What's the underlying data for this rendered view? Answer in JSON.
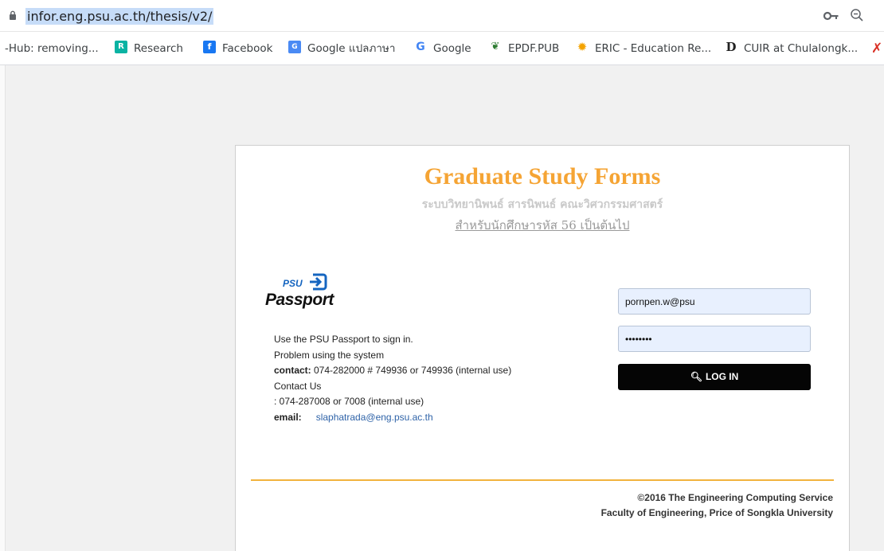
{
  "browser": {
    "url": "infor.eng.psu.ac.th/thesis/v2/",
    "bookmarks": [
      {
        "label": "-Hub: removing..."
      },
      {
        "label": "Research",
        "icon": "researchgate-icon"
      },
      {
        "label": "Facebook",
        "icon": "facebook-icon"
      },
      {
        "label": "Google แปลภาษา",
        "icon": "google-translate-icon"
      },
      {
        "label": "Google",
        "icon": "google-icon"
      },
      {
        "label": "EPDF.PUB",
        "icon": "epdf-icon"
      },
      {
        "label": "ERIC - Education Re...",
        "icon": "eric-icon"
      },
      {
        "label": "CUIR at Chulalongk...",
        "icon": "cuir-icon"
      }
    ]
  },
  "page": {
    "title": "Graduate Study Forms",
    "subtitle": "ระบบวิทยานิพนธ์ สารนิพนธ์ คณะวิศวกรรมศาสตร์",
    "sublink": "สำหรับนักศึกษารหัส 56 เป็นต้นไป",
    "logo": {
      "top": "PSU",
      "bottom": "Passport"
    },
    "info": {
      "line1": "Use the PSU Passport to sign in.",
      "line2": "Problem using the system",
      "contact_label": "contact:",
      "contact_value": " 074-282000 # 749936 or 749936 (internal use)",
      "line4": "Contact Us",
      "line5": ": 074-287008 or 7008 (internal use)",
      "email_label": "email:",
      "email_value": "slaphatrada@eng.psu.ac.th"
    },
    "form": {
      "username": "pornpen.w@psu",
      "password": "••••••••",
      "login_label": "LOG IN"
    },
    "footer": {
      "line1": "©2016 The Engineering Computing Service",
      "line2": "Faculty of Engineering, Price of Songkla University"
    },
    "colors": {
      "accent": "#f5a434",
      "divider": "#f2b33d",
      "button": "#050505",
      "link": "#2f63a8"
    }
  }
}
